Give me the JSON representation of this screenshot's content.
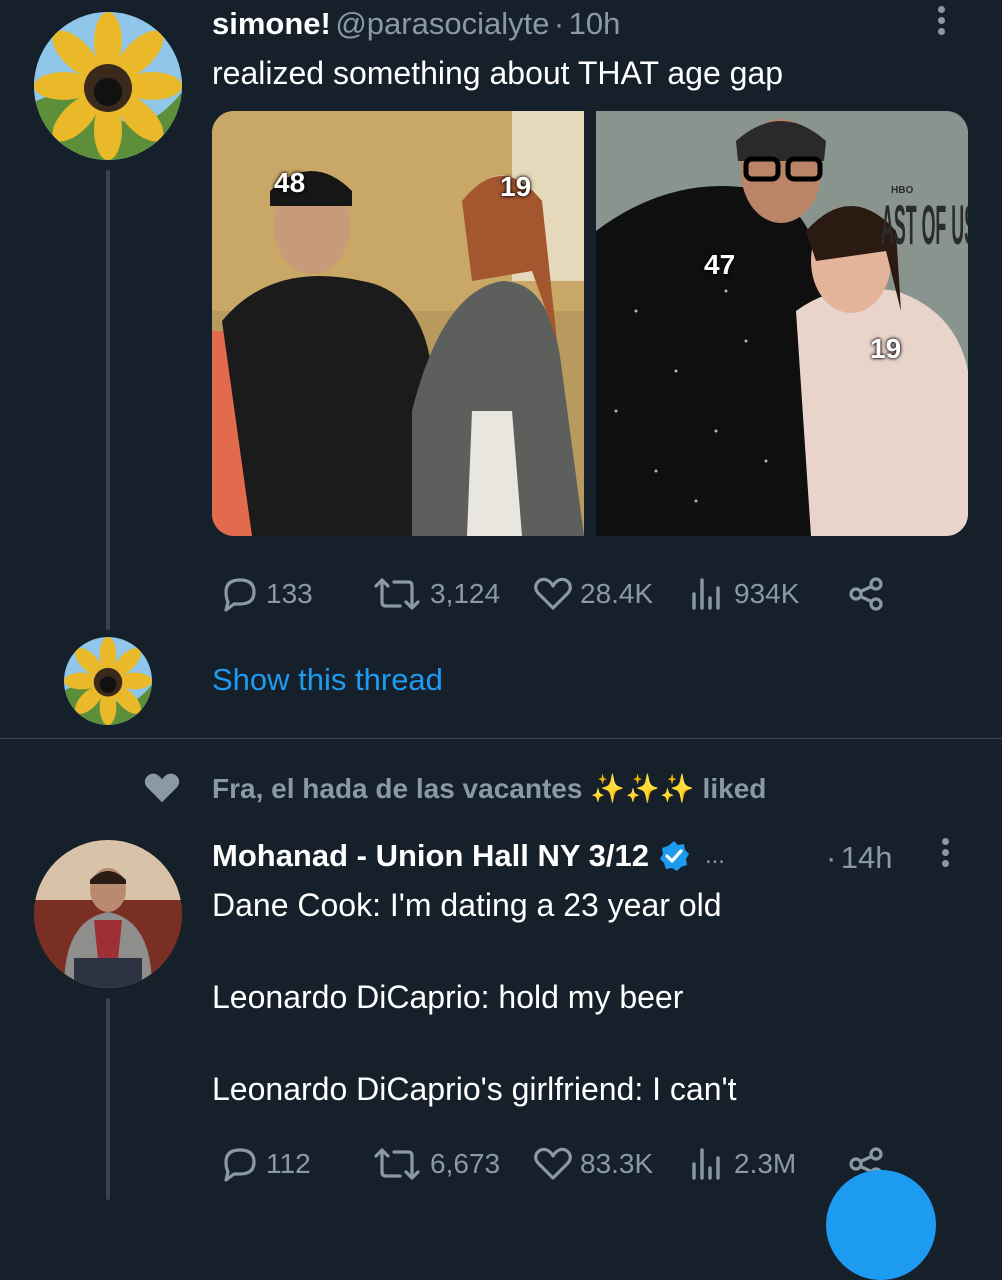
{
  "tweet1": {
    "name": "simone!",
    "handle": "@parasocialyte",
    "separator": "·",
    "time": "10h",
    "text": "realized something about THAT age gap",
    "images": [
      {
        "labels": [
          "48",
          "19"
        ]
      },
      {
        "labels": [
          "47",
          "19"
        ],
        "sign_text": "AST OF US",
        "sign_small": "HBO"
      }
    ],
    "stats": {
      "replies": "133",
      "retweets": "3,124",
      "likes": "28.4K",
      "views": "934K"
    },
    "show_thread": "Show this thread"
  },
  "liked_banner": {
    "text": "Fra, el hada de las vacantes ✨✨✨ liked"
  },
  "tweet2": {
    "name": "Mohanad - Union Hall NY 3/12",
    "ellipsis": "...",
    "separator": "·",
    "time": "14h",
    "lines": [
      "Dane Cook: I'm dating a 23 year old",
      "Leonardo DiCaprio: hold my beer",
      "Leonardo DiCaprio's girlfriend: I can't"
    ],
    "stats": {
      "replies": "112",
      "retweets": "6,673",
      "likes": "83.3K",
      "views": "2.3M"
    }
  },
  "colors": {
    "background": "#15202b",
    "muted": "#8b98a5",
    "accent": "#1d9bf0",
    "divider": "#38444d"
  }
}
